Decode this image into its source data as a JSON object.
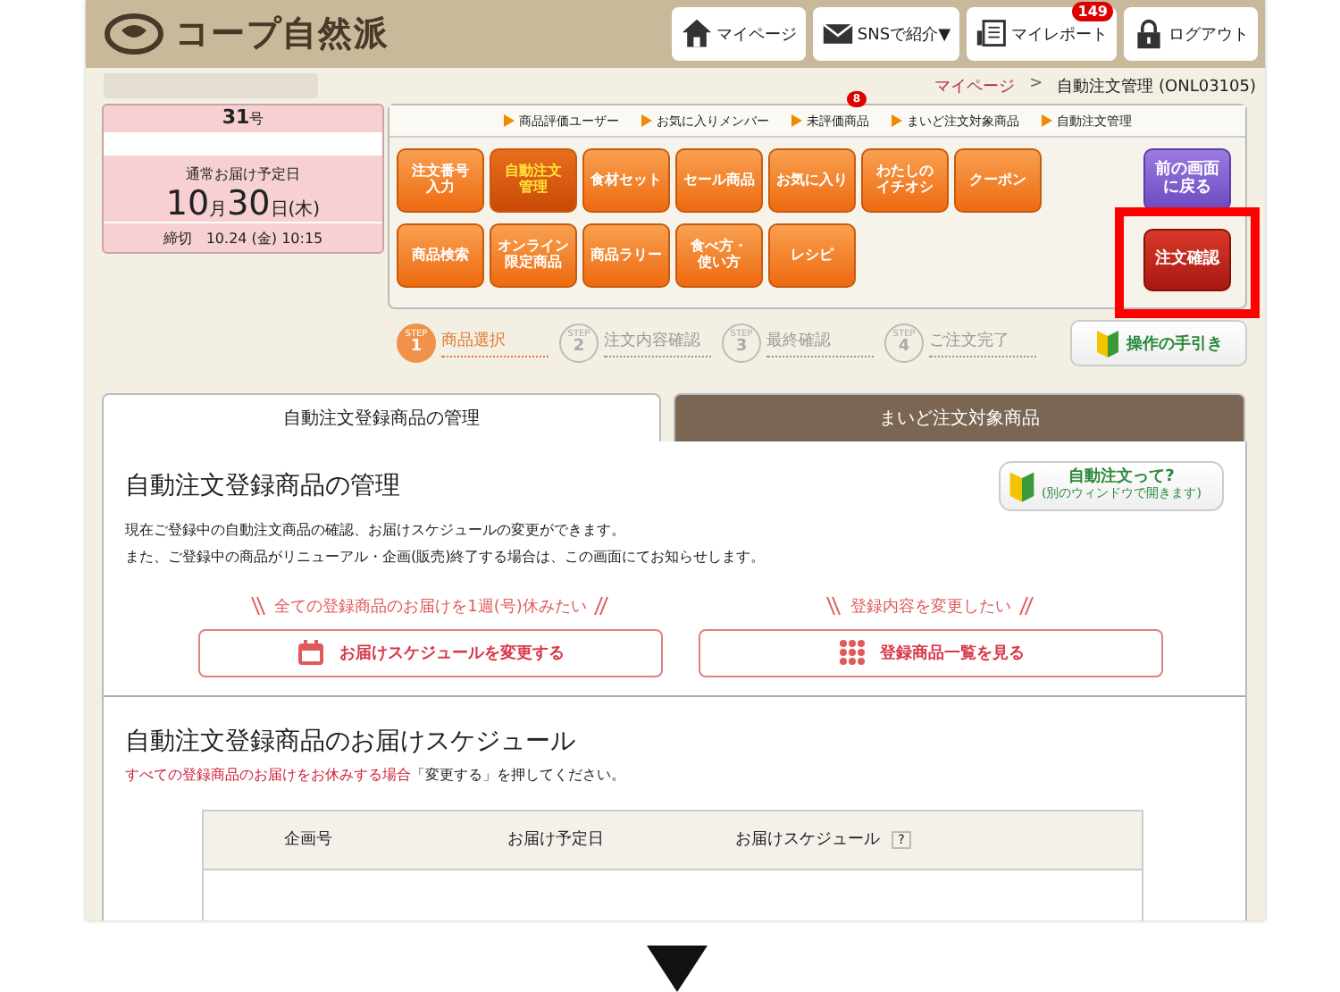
{
  "header": {
    "logo": "コープ自然派",
    "nav": [
      {
        "label": "マイページ"
      },
      {
        "label": "SNSで紹介▼"
      },
      {
        "label": "マイレポート",
        "badge": "149"
      },
      {
        "label": "ログアウト"
      }
    ]
  },
  "breadcrumb": [
    {
      "label": "マイページ",
      "kind": "link"
    },
    {
      "label": ">",
      "kind": "separator"
    },
    {
      "label": "自動注文管理 (ONL03105)",
      "kind": "current"
    }
  ],
  "issue_card": {
    "number": "31",
    "suffix": "号",
    "delivery_label": "通常お届け予定日",
    "date_parts": [
      {
        "text": "10",
        "kind": "big"
      },
      {
        "text": "月",
        "kind": "small"
      },
      {
        "text": "30",
        "kind": "big"
      },
      {
        "text": "日",
        "kind": "small"
      },
      {
        "text": " (木)",
        "kind": "small"
      }
    ],
    "deadline": "締切　10.24 (金) 10:15"
  },
  "quick_links": [
    {
      "label": "商品評価ユーザー"
    },
    {
      "label": "お気に入りメンバー"
    },
    {
      "label": "未評価商品",
      "badge": "8"
    },
    {
      "label": "まいど注文対象商品"
    },
    {
      "label": "自動注文管理"
    }
  ],
  "menu_rows": [
    [
      {
        "lines": [
          "注文番号",
          "入力"
        ],
        "selected": false
      },
      {
        "lines": [
          "自動注文",
          "管理"
        ],
        "selected": true
      },
      {
        "lines": [
          "食材セット"
        ],
        "selected": false
      },
      {
        "lines": [
          "セール商品"
        ],
        "selected": false
      },
      {
        "lines": [
          "お気に入り"
        ],
        "selected": false
      },
      {
        "lines": [
          "わたしの",
          "イチオシ"
        ],
        "selected": false
      },
      {
        "lines": [
          "クーポン"
        ],
        "selected": false
      }
    ],
    [
      {
        "lines": [
          "商品検索"
        ],
        "selected": false
      },
      {
        "lines": [
          "オンライン",
          "限定商品"
        ],
        "selected": false
      },
      {
        "lines": [
          "商品ラリー"
        ],
        "selected": false
      },
      {
        "lines": [
          "食べ方・",
          "使い方"
        ],
        "selected": false
      },
      {
        "lines": [
          "レシピ"
        ],
        "selected": false
      }
    ]
  ],
  "side_buttons": [
    {
      "lines": [
        "前の画面",
        "に戻る"
      ],
      "kind": "back",
      "highlighted": false
    },
    {
      "lines": [
        "注文確認"
      ],
      "kind": "confirm",
      "highlighted": true
    }
  ],
  "steps": [
    {
      "tag": "STEP",
      "number": "1",
      "label": "商品選択",
      "selected": true
    },
    {
      "tag": "STEP",
      "number": "2",
      "label": "注文内容確認",
      "selected": false
    },
    {
      "tag": "STEP",
      "number": "3",
      "label": "最終確認",
      "selected": false
    },
    {
      "tag": "STEP",
      "number": "4",
      "label": "ご注文完了",
      "selected": false
    }
  ],
  "guide_button": "操作の手引き",
  "tabs": [
    {
      "label": "自動注文登録商品の管理",
      "selected": true
    },
    {
      "label": "まいど注文対象商品",
      "selected": false
    }
  ],
  "management": {
    "title": "自動注文登録商品の管理",
    "help_button": {
      "title": "自動注文って?",
      "subtitle": "(別のウィンドウで開きます)"
    },
    "description": [
      "現在ご登録中の自動注文商品の確認、お届けスケジュールの変更ができます。",
      "また、ご登録中の商品がリニューアル・企画(販売)終了する場合は、この画面にてお知らせします。"
    ],
    "actions": [
      {
        "caption": "全ての登録商品のお届けを1週(号)休みたい",
        "button": "お届けスケジュールを変更する"
      },
      {
        "caption": "登録内容を変更したい",
        "button": "登録商品一覧を見る"
      }
    ]
  },
  "schedule": {
    "title": "自動注文登録商品のお届けスケジュール",
    "note_highlight": "すべての登録商品のお届けをお休みする場合",
    "note_rest": "「変更する」を押してください。",
    "columns": [
      {
        "label": "企画号"
      },
      {
        "label": "お届け予定日"
      },
      {
        "label": "お届けスケジュール",
        "help": "?"
      }
    ]
  }
}
